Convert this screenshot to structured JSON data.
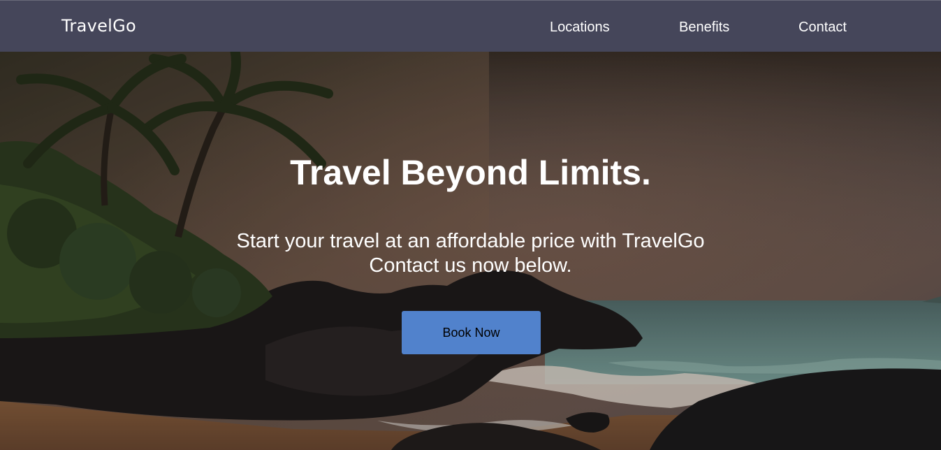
{
  "nav": {
    "brand": "TravelGo",
    "links": [
      "Locations",
      "Benefits",
      "Contact"
    ]
  },
  "hero": {
    "title": "Travel Beyond Limits.",
    "subtitle_line1": "Start your travel at an affordable price with TravelGo",
    "subtitle_line2": "Contact us now below.",
    "cta_label": "Book Now",
    "background": "beach-sunset-photo"
  },
  "colors": {
    "navbar": "#45465a",
    "button": "#5182cc",
    "text": "#ffffff"
  }
}
